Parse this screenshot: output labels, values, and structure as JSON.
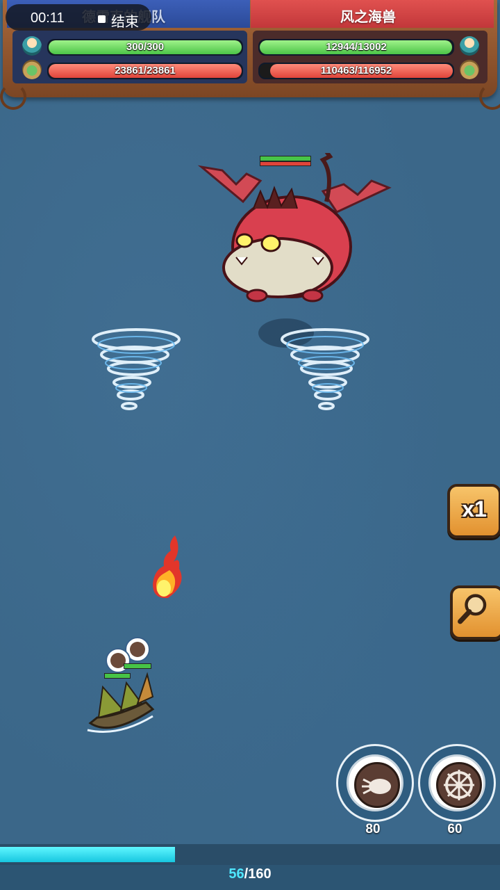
{
  "recorder": {
    "time": "00:11",
    "end_label": "结束"
  },
  "player_team": {
    "name": "德雷克的舰队",
    "crew_hp": "300/300",
    "crew_ratio": 1.0,
    "ship_hp": "23861/23861",
    "ship_ratio": 1.0
  },
  "enemy_team": {
    "name": "风之海兽",
    "crew_hp": "12944/13002",
    "crew_ratio": 0.9955,
    "ship_hp": "110463/116952",
    "ship_ratio": 0.9445
  },
  "controls": {
    "speed_label": "x1",
    "zoom_icon": "magnifier-icon"
  },
  "skills": [
    {
      "icon": "cannon-shot-icon",
      "cost": "80"
    },
    {
      "icon": "ship-wheel-icon",
      "cost": "60"
    }
  ],
  "energy": {
    "current": "56",
    "max": "/160",
    "ratio": 0.35
  },
  "colors": {
    "player": "#3c5fb8",
    "enemy": "#e0514f",
    "energy": "#2fd6ec"
  }
}
